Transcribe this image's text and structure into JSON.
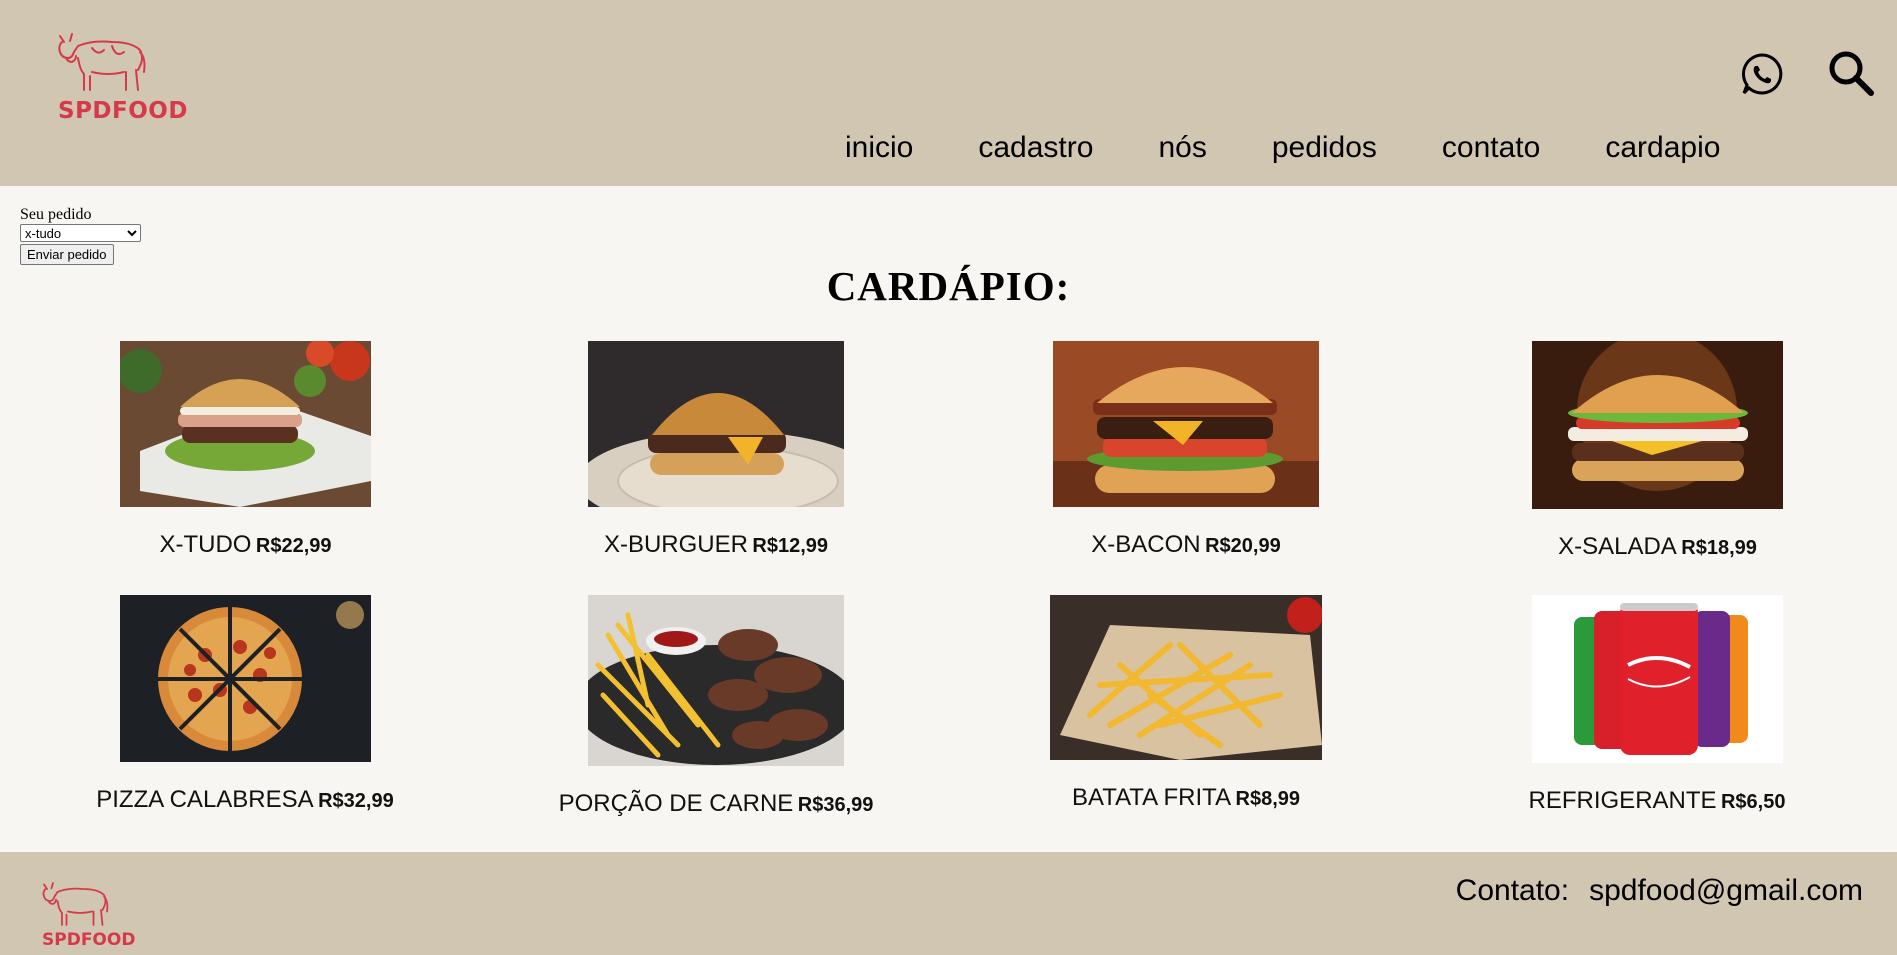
{
  "brand": {
    "logo_text": "SPDFOOD"
  },
  "header": {
    "icons": {
      "whatsapp": "whatsapp-icon",
      "search": "search-icon"
    },
    "nav": [
      "inicio",
      "cadastro",
      "nós",
      "pedidos",
      "contato",
      "cardapio"
    ]
  },
  "order_form": {
    "label": "Seu pedido",
    "selected": "x-tudo",
    "submit": "Enviar pedido"
  },
  "menu": {
    "title": "CARDÁPIO:",
    "items": [
      {
        "name": "X-TUDO",
        "price": "R$22,99"
      },
      {
        "name": "X-BURGUER",
        "price": "R$12,99"
      },
      {
        "name": "X-BACON",
        "price": "R$20,99"
      },
      {
        "name": "X-SALADA",
        "price": "R$18,99"
      },
      {
        "name": "PIZZA CALABRESA",
        "price": "R$32,99"
      },
      {
        "name": "PORÇÃO DE CARNE",
        "price": "R$36,99"
      },
      {
        "name": "BATATA FRITA",
        "price": "R$8,99"
      },
      {
        "name": "REFRIGERANTE",
        "price": "R$6,50"
      }
    ]
  },
  "footer": {
    "logo_text": "SPDFOOD",
    "contact_label": "Contato:",
    "contact_email": "spdfood@gmail.com"
  },
  "colors": {
    "header_bg": "#d0c6b1",
    "page_bg": "#f8f6f3",
    "brand_red": "#d63a4a"
  }
}
